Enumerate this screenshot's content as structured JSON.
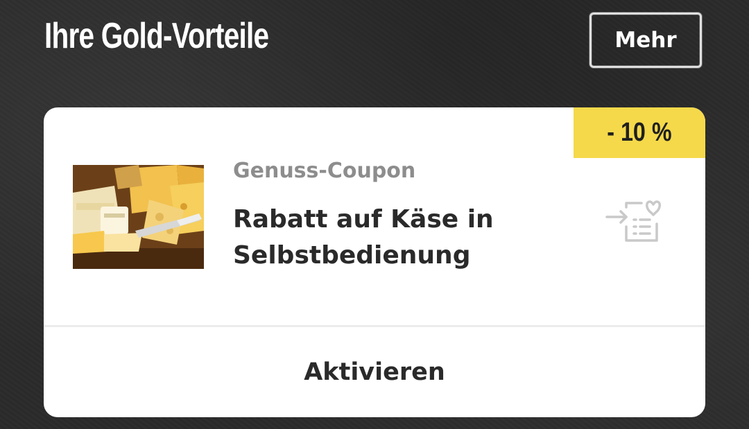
{
  "header": {
    "title": "Ihre Gold-Vorteile",
    "more_label": "Mehr"
  },
  "coupon": {
    "discount": "- 10 %",
    "category": "Genuss-Coupon",
    "title": "Rabatt auf Käse in Selbstbedienung",
    "image_subject": "cheese assortment",
    "action_icon": "coupon-activate-icon",
    "activate_label": "Aktivieren"
  },
  "colors": {
    "badge": "#f5d94a",
    "card": "#ffffff",
    "background": "#2b2b2b",
    "category_text": "#8d8d8d",
    "body_text": "#2a2a2a"
  }
}
